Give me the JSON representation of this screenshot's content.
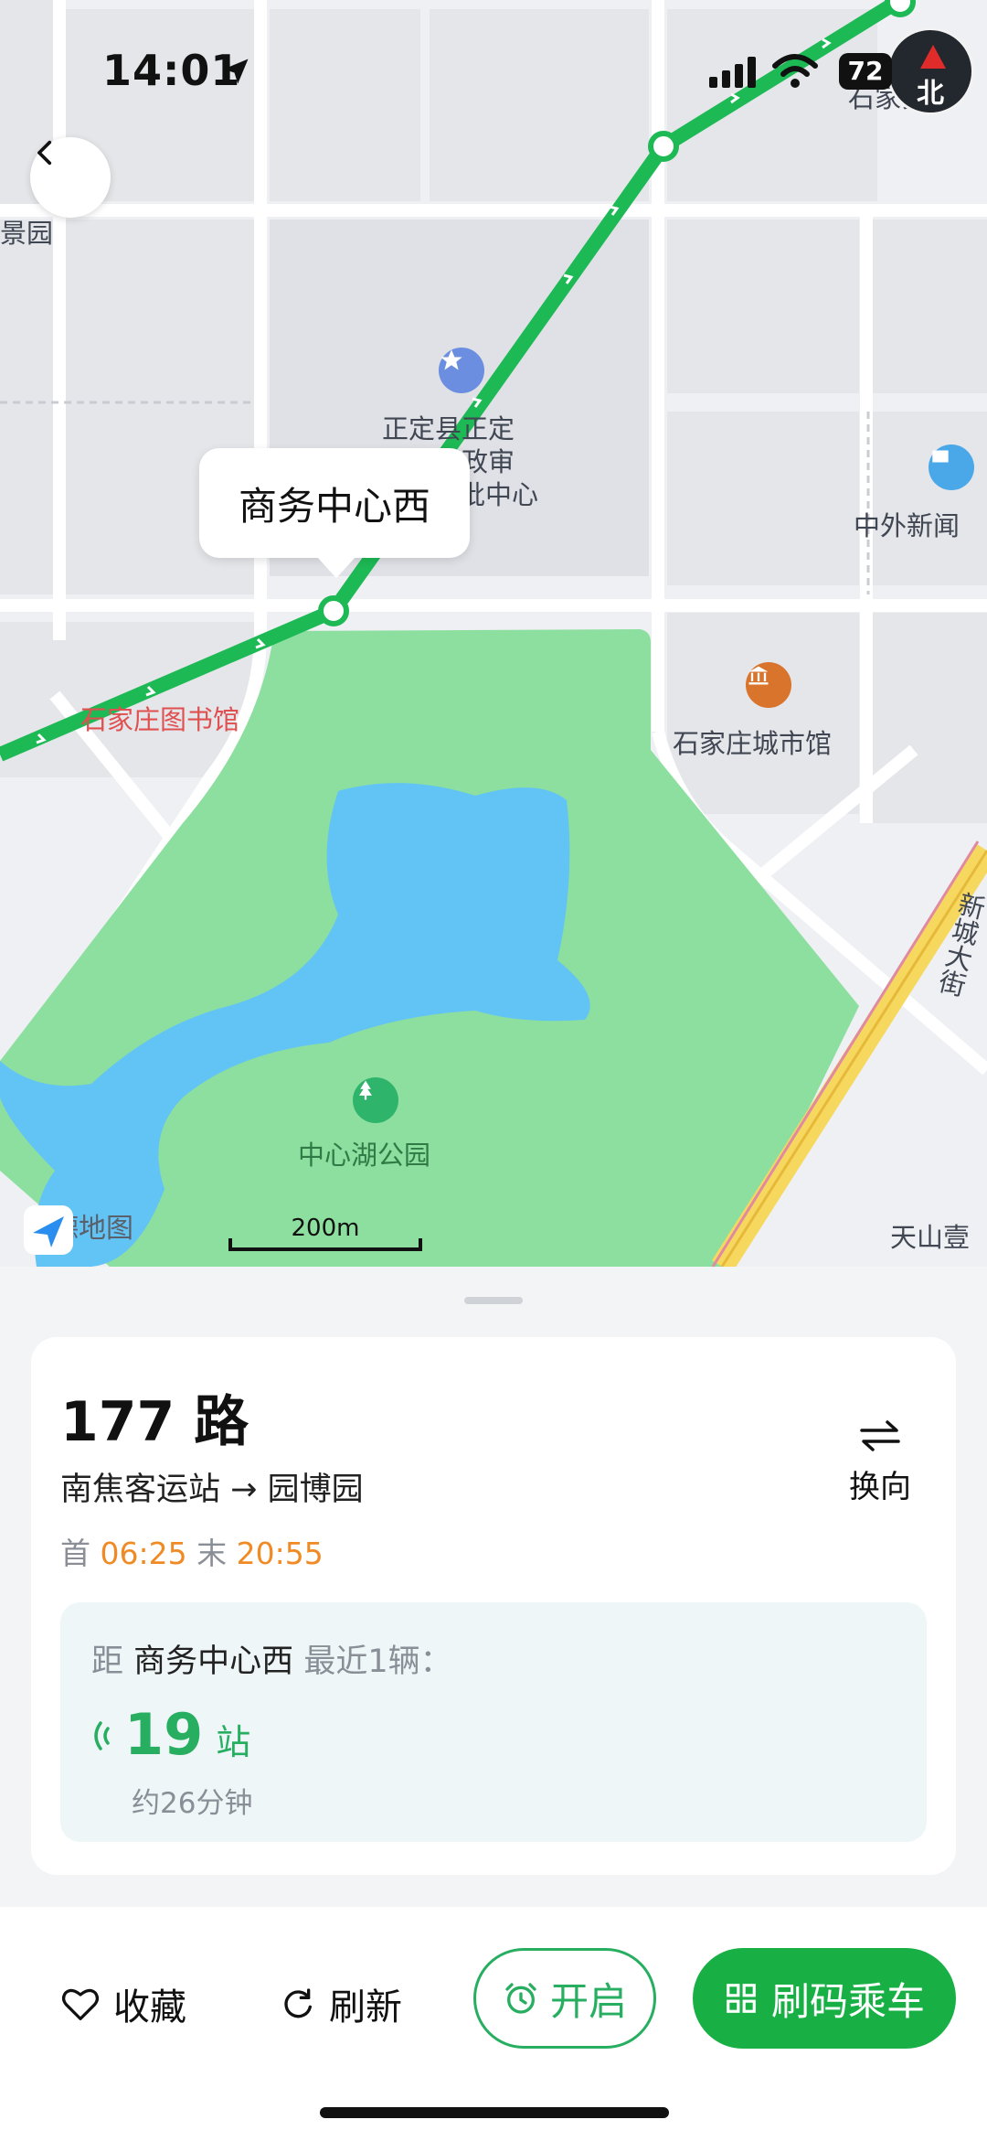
{
  "status_bar": {
    "time": "14:01",
    "battery": "72"
  },
  "map": {
    "compass_label": "北",
    "stop_callout": "商务中心西",
    "labels": {
      "jingyuan": "景园",
      "gov_center_1": "正定县正定",
      "gov_center_2": "新区行政审",
      "gov_center_3": "批中心",
      "news": "中外新闻",
      "library": "石家庄图书馆",
      "city_museum": "石家庄城市馆",
      "xincheng_road": "新城大街",
      "park": "中心湖公园",
      "tianshan": "天山壹",
      "top_right": "石家安娱"
    },
    "brand": "高德地图",
    "scale": "200m"
  },
  "route": {
    "name": "177 路",
    "from": "南焦客运站",
    "arrow": "→",
    "to": "园博园",
    "first_label": "首",
    "first_time": "06:25",
    "last_label": "末",
    "last_time": "20:55",
    "switch_label": "换向"
  },
  "eta": {
    "prefix": "距",
    "stop": "商务中心西",
    "suffix": "最近1辆：",
    "stops_count": "19",
    "stops_unit": "站",
    "minutes": "约26分钟"
  },
  "actions": {
    "favorite": "收藏",
    "refresh": "刷新",
    "alarm": "开启",
    "pay": "刷码乘车"
  },
  "colors": {
    "route_green": "#1db954",
    "accent_orange": "#f08a24",
    "park_green": "#8ddf9f",
    "lake_blue": "#62c3f5"
  }
}
